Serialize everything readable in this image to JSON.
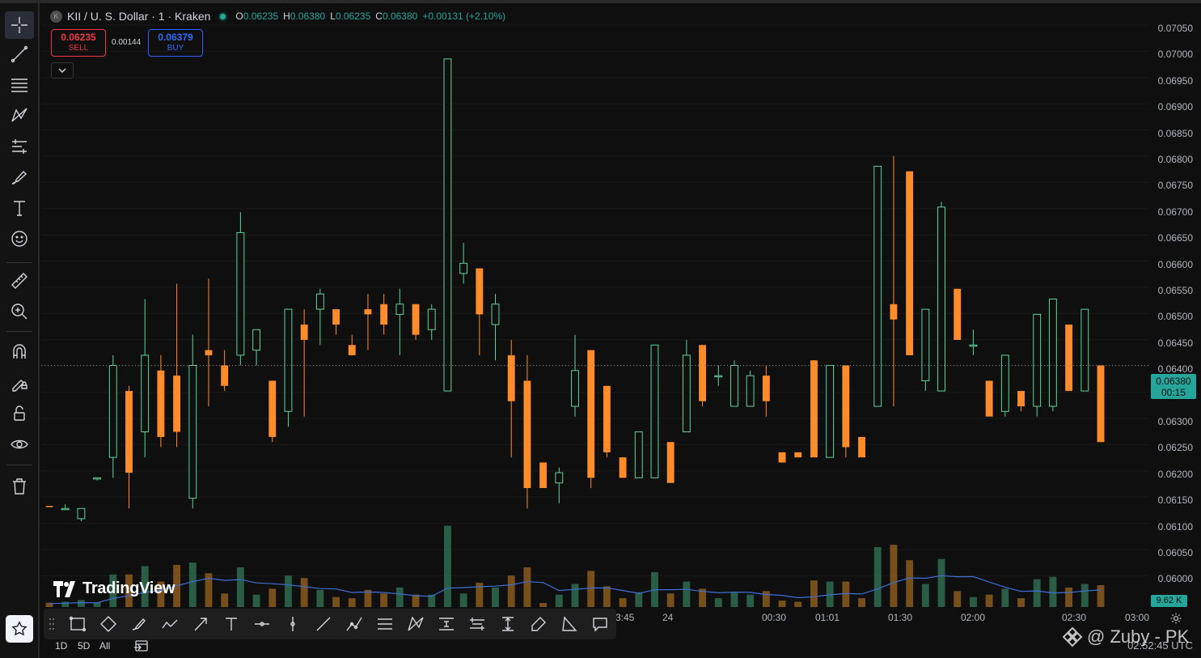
{
  "header": {
    "symbol_icon": "K",
    "symbol_title": "KII / U. S. Dollar · 1 · Kraken",
    "open_label": "O",
    "open": "0.06235",
    "high_label": "H",
    "high": "0.06380",
    "low_label": "L",
    "low": "0.06235",
    "close_label": "C",
    "close": "0.06380",
    "change": "+0.00131 (+2.10%)"
  },
  "trade": {
    "sell_price": "0.06235",
    "sell_label": "SELL",
    "spread": "0.00144",
    "buy_price": "0.06379",
    "buy_label": "BUY"
  },
  "price_axis": {
    "ticks": [
      "0.07050",
      "0.07000",
      "0.06950",
      "0.06900",
      "0.06850",
      "0.06800",
      "0.06750",
      "0.06700",
      "0.06650",
      "0.06600",
      "0.06550",
      "0.06500",
      "0.06450",
      "0.06400",
      "0.06350",
      "0.06300",
      "0.06250",
      "0.06200",
      "0.06150",
      "0.06100",
      "0.06050",
      "0.06000"
    ],
    "current_price": "0.06380",
    "countdown": "00:15",
    "volume_label": "9.62 K"
  },
  "time_axis": {
    "ticks": [
      {
        "label": "23:45",
        "visible": "3:45"
      },
      {
        "label": "24"
      },
      {
        "label": "00:30"
      },
      {
        "label": "01:01"
      },
      {
        "label": "01:30"
      },
      {
        "label": "02:00"
      },
      {
        "label": "02:30"
      },
      {
        "label": "03:00"
      }
    ]
  },
  "bottom": {
    "ranges": [
      "1D",
      "5D",
      "All"
    ],
    "utc_time": "02:52:45 UTC"
  },
  "branding": {
    "logo_text": "TradingView",
    "watermark": "@ Zuby - PK"
  },
  "colors": {
    "up": "#5ed49a",
    "down": "#ff8c2a",
    "ma": "#3f6fd6",
    "background": "#0f0f0f",
    "sell": "#f23645",
    "buy": "#2962ff",
    "last_price": "#26a69a"
  },
  "icons": {
    "left_toolbar": [
      "crosshair-icon",
      "trend-line-icon",
      "fib-retracement-icon",
      "pattern-icon",
      "forecast-icon",
      "brush-icon",
      "text-icon",
      "emoji-icon",
      "ruler-icon",
      "zoom-in-icon",
      "magnet-icon",
      "lock-drawings-icon",
      "lock-icon",
      "eye-icon",
      "trash-icon",
      "star-icon"
    ],
    "drawing_bar": [
      "rectangle-icon",
      "rotated-rectangle-icon",
      "brush-icon",
      "path-icon",
      "arrow-icon",
      "text-icon",
      "horizontal-ray-icon",
      "vertical-line-icon",
      "line-icon",
      "polyline-icon",
      "parallel-channel-icon",
      "pitchfork-icon",
      "pricerange-icon",
      "datarange-icon",
      "date-price-range-icon",
      "brush-highlighter-icon",
      "triangle-icon",
      "callout-icon"
    ]
  },
  "chart_data": {
    "type": "candlestick",
    "y_range": [
      0.0598,
      0.0707
    ],
    "last_price_line": 0.0638,
    "candles": [
      {
        "o": 0.06105,
        "h": 0.06105,
        "l": 0.06103,
        "c": 0.06103
      },
      {
        "o": 0.061,
        "h": 0.06108,
        "l": 0.06098,
        "c": 0.061
      },
      {
        "o": 0.0608,
        "h": 0.061,
        "l": 0.06075,
        "c": 0.061
      },
      {
        "o": 0.0616,
        "h": 0.0616,
        "l": 0.06155,
        "c": 0.0616
      },
      {
        "o": 0.062,
        "h": 0.064,
        "l": 0.0616,
        "c": 0.0638
      },
      {
        "o": 0.0633,
        "h": 0.0634,
        "l": 0.061,
        "c": 0.0617
      },
      {
        "o": 0.0625,
        "h": 0.0651,
        "l": 0.062,
        "c": 0.064
      },
      {
        "o": 0.0637,
        "h": 0.064,
        "l": 0.0622,
        "c": 0.0624
      },
      {
        "o": 0.0636,
        "h": 0.0654,
        "l": 0.0622,
        "c": 0.0625
      },
      {
        "o": 0.0612,
        "h": 0.0644,
        "l": 0.061,
        "c": 0.0638
      },
      {
        "o": 0.0641,
        "h": 0.0655,
        "l": 0.063,
        "c": 0.064
      },
      {
        "o": 0.0638,
        "h": 0.0641,
        "l": 0.0633,
        "c": 0.0634
      },
      {
        "o": 0.064,
        "h": 0.0668,
        "l": 0.0638,
        "c": 0.0664
      },
      {
        "o": 0.0641,
        "h": 0.0645,
        "l": 0.0638,
        "c": 0.0645
      },
      {
        "o": 0.0635,
        "h": 0.0635,
        "l": 0.0623,
        "c": 0.0624
      },
      {
        "o": 0.0629,
        "h": 0.0649,
        "l": 0.0626,
        "c": 0.0649
      },
      {
        "o": 0.0646,
        "h": 0.0649,
        "l": 0.0628,
        "c": 0.0643
      },
      {
        "o": 0.0649,
        "h": 0.0653,
        "l": 0.0642,
        "c": 0.0652
      },
      {
        "o": 0.0649,
        "h": 0.0649,
        "l": 0.0644,
        "c": 0.0646
      },
      {
        "o": 0.0642,
        "h": 0.0644,
        "l": 0.064,
        "c": 0.064
      },
      {
        "o": 0.0649,
        "h": 0.0652,
        "l": 0.0641,
        "c": 0.0648
      },
      {
        "o": 0.065,
        "h": 0.0652,
        "l": 0.0644,
        "c": 0.0646
      },
      {
        "o": 0.0648,
        "h": 0.0653,
        "l": 0.064,
        "c": 0.065
      },
      {
        "o": 0.065,
        "h": 0.065,
        "l": 0.0643,
        "c": 0.0644
      },
      {
        "o": 0.0645,
        "h": 0.065,
        "l": 0.0643,
        "c": 0.0649
      },
      {
        "o": 0.0633,
        "h": 0.0698,
        "l": 0.0633,
        "c": 0.0698
      },
      {
        "o": 0.0656,
        "h": 0.0662,
        "l": 0.0654,
        "c": 0.0658
      },
      {
        "o": 0.0657,
        "h": 0.0657,
        "l": 0.064,
        "c": 0.0648
      },
      {
        "o": 0.0646,
        "h": 0.0652,
        "l": 0.0639,
        "c": 0.065
      },
      {
        "o": 0.064,
        "h": 0.0643,
        "l": 0.062,
        "c": 0.0631
      },
      {
        "o": 0.0635,
        "h": 0.064,
        "l": 0.061,
        "c": 0.0614
      },
      {
        "o": 0.0619,
        "h": 0.0614,
        "l": 0.0614,
        "c": 0.0614
      },
      {
        "o": 0.0615,
        "h": 0.0618,
        "l": 0.0611,
        "c": 0.0617
      },
      {
        "o": 0.063,
        "h": 0.0644,
        "l": 0.0628,
        "c": 0.0637
      },
      {
        "o": 0.0641,
        "h": 0.0641,
        "l": 0.0614,
        "c": 0.0616
      },
      {
        "o": 0.0634,
        "h": 0.0634,
        "l": 0.062,
        "c": 0.0621
      },
      {
        "o": 0.062,
        "h": 0.062,
        "l": 0.0616,
        "c": 0.0616
      },
      {
        "o": 0.0616,
        "h": 0.0625,
        "l": 0.0616,
        "c": 0.0625
      },
      {
        "o": 0.0616,
        "h": 0.0642,
        "l": 0.0616,
        "c": 0.0642
      },
      {
        "o": 0.0623,
        "h": 0.0623,
        "l": 0.0615,
        "c": 0.0615
      },
      {
        "o": 0.0625,
        "h": 0.0643,
        "l": 0.0625,
        "c": 0.064
      },
      {
        "o": 0.0642,
        "h": 0.0642,
        "l": 0.063,
        "c": 0.0631
      },
      {
        "o": 0.0636,
        "h": 0.0638,
        "l": 0.0634,
        "c": 0.0636
      },
      {
        "o": 0.063,
        "h": 0.0639,
        "l": 0.063,
        "c": 0.0638
      },
      {
        "o": 0.063,
        "h": 0.0637,
        "l": 0.063,
        "c": 0.0636
      },
      {
        "o": 0.0636,
        "h": 0.0638,
        "l": 0.0628,
        "c": 0.0631
      },
      {
        "o": 0.0621,
        "h": 0.0621,
        "l": 0.0619,
        "c": 0.0619
      },
      {
        "o": 0.0621,
        "h": 0.0621,
        "l": 0.062,
        "c": 0.062
      },
      {
        "o": 0.0639,
        "h": 0.0639,
        "l": 0.062,
        "c": 0.062
      },
      {
        "o": 0.062,
        "h": 0.0638,
        "l": 0.062,
        "c": 0.0638
      },
      {
        "o": 0.0638,
        "h": 0.0638,
        "l": 0.062,
        "c": 0.0622
      },
      {
        "o": 0.0624,
        "h": 0.0624,
        "l": 0.062,
        "c": 0.062
      },
      {
        "o": 0.063,
        "h": 0.0677,
        "l": 0.063,
        "c": 0.0677
      },
      {
        "o": 0.065,
        "h": 0.0679,
        "l": 0.063,
        "c": 0.0647
      },
      {
        "o": 0.0676,
        "h": 0.0676,
        "l": 0.064,
        "c": 0.064
      },
      {
        "o": 0.0635,
        "h": 0.0649,
        "l": 0.0633,
        "c": 0.0649
      },
      {
        "o": 0.0633,
        "h": 0.067,
        "l": 0.0633,
        "c": 0.0669
      },
      {
        "o": 0.0653,
        "h": 0.0653,
        "l": 0.0643,
        "c": 0.0643
      },
      {
        "o": 0.0642,
        "h": 0.0645,
        "l": 0.064,
        "c": 0.0642
      },
      {
        "o": 0.0635,
        "h": 0.0635,
        "l": 0.0628,
        "c": 0.0628
      },
      {
        "o": 0.0629,
        "h": 0.064,
        "l": 0.0628,
        "c": 0.064
      },
      {
        "o": 0.0633,
        "h": 0.0633,
        "l": 0.0629,
        "c": 0.063
      },
      {
        "o": 0.063,
        "h": 0.0648,
        "l": 0.0628,
        "c": 0.0648
      },
      {
        "o": 0.063,
        "h": 0.0651,
        "l": 0.0629,
        "c": 0.0651
      },
      {
        "o": 0.0646,
        "h": 0.0646,
        "l": 0.0633,
        "c": 0.0633
      },
      {
        "o": 0.0633,
        "h": 0.0649,
        "l": 0.0633,
        "c": 0.0649
      },
      {
        "o": 0.0638,
        "h": 0.0638,
        "l": 0.0623,
        "c": 0.0623
      }
    ]
  }
}
